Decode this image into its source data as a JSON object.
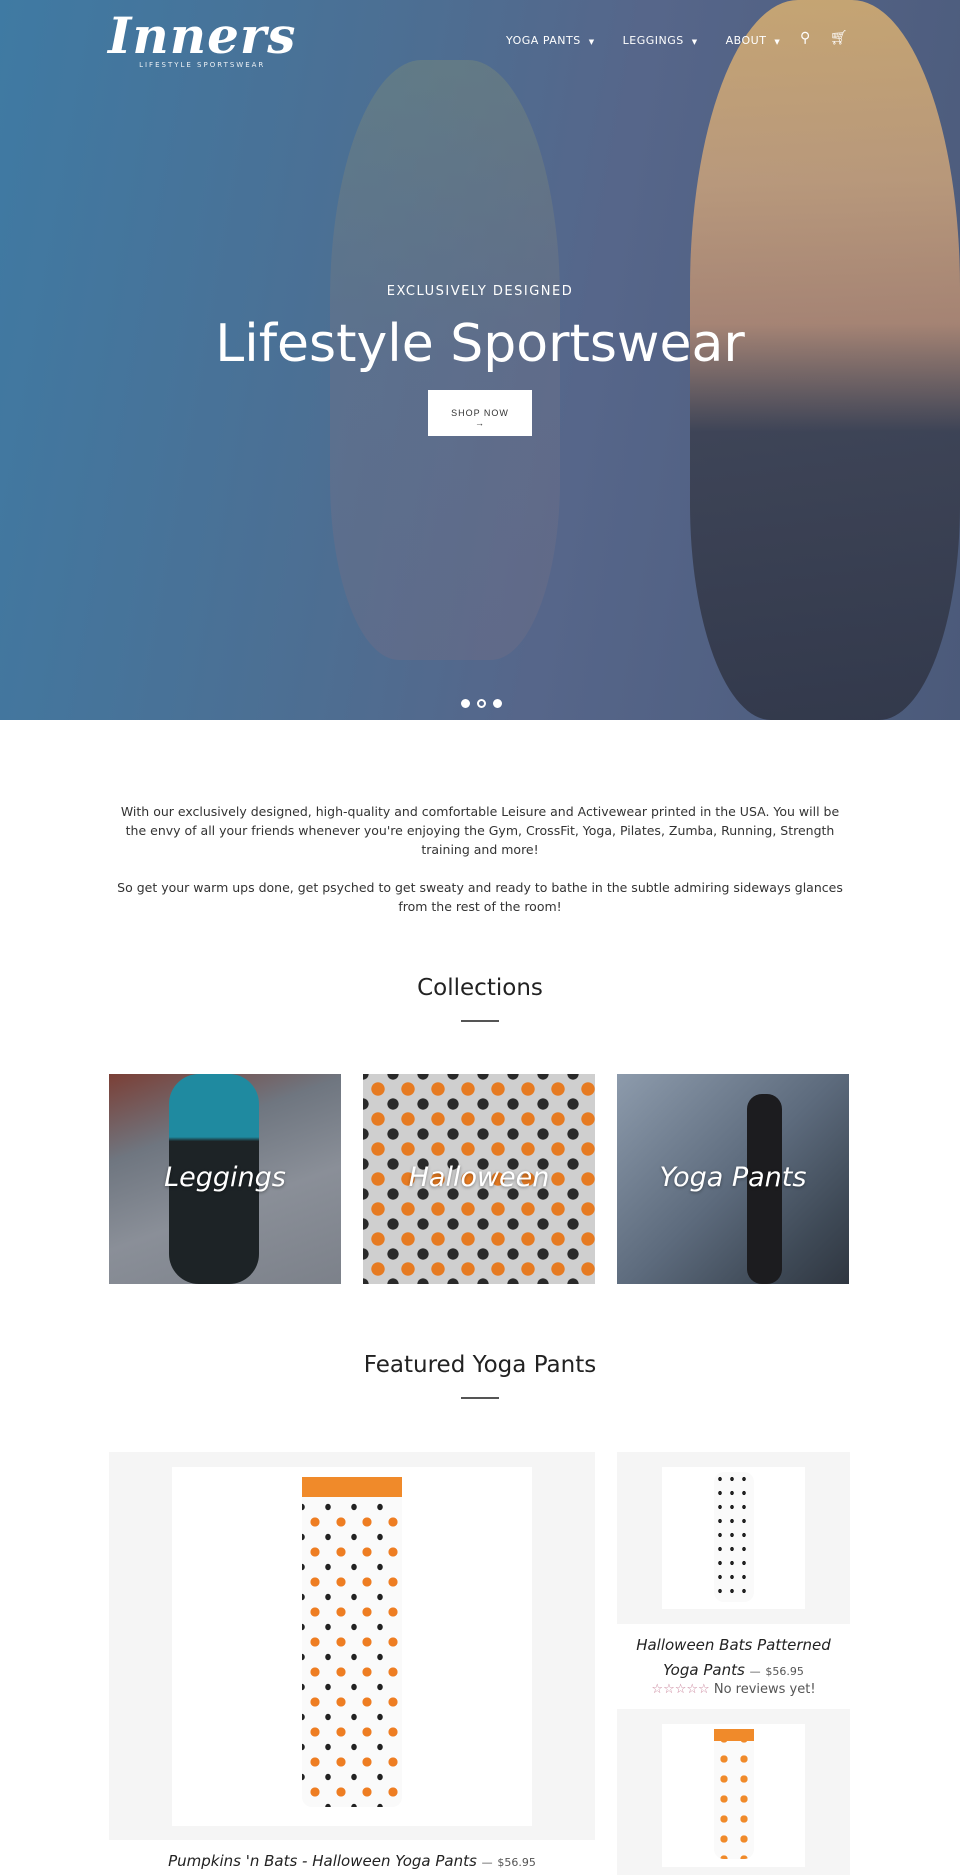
{
  "header": {
    "logo": "Inners",
    "tagline": "LIFESTYLE SPORTSWEAR",
    "nav": [
      {
        "label": "YOGA PANTS"
      },
      {
        "label": "LEGGINGS"
      },
      {
        "label": "ABOUT"
      }
    ],
    "search_icon": "search-icon",
    "cart_icon": "cart-icon"
  },
  "hero": {
    "subtitle": "EXCLUSIVELY DESIGNED",
    "title": "Lifestyle Sportswear",
    "button": "SHOP NOW",
    "button_arrow": "→",
    "slides": 3,
    "active_slide": 2
  },
  "intro": {
    "p1": "With our exclusively designed, high-quality and comfortable Leisure and Activewear printed in the USA. You will be the envy of all your friends whenever you're enjoying the Gym, CrossFit, Yoga, Pilates, Zumba, Running, Strength training and more!",
    "p2": "So get your warm ups done, get psyched to get sweaty and ready to bathe in the subtle admiring sideways glances from the rest of the room!"
  },
  "collections": {
    "title": "Collections",
    "items": [
      {
        "label": "Leggings"
      },
      {
        "label": "Halloween"
      },
      {
        "label": "Yoga Pants"
      }
    ]
  },
  "featured": {
    "title": "Featured Yoga Pants",
    "products": [
      {
        "name": "Pumpkins 'n Bats - Halloween Yoga Pants",
        "price": "$56.95"
      },
      {
        "name": "Halloween Bats Patterned Yoga Pants",
        "price": "$56.95",
        "reviews": "No reviews yet!",
        "stars": "☆☆☆☆☆"
      }
    ],
    "separator": "—"
  },
  "colors": {
    "hero_overlay": "#4a6a92",
    "accent": "#f08a2a",
    "star": "#c9849b"
  }
}
